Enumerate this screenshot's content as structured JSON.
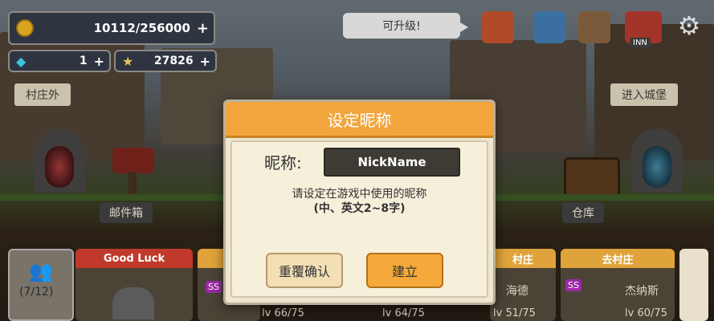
{
  "currency": {
    "gold": "10112/256000",
    "gems": "1",
    "stars": "27826",
    "plus": "+"
  },
  "tooltip": "可升级!",
  "top_icons": [
    "forge-icon",
    "shop-icon",
    "gem-cart-icon",
    "inn-icon",
    "gear-icon"
  ],
  "inn_label": "INN",
  "signs": {
    "left": "村庄外",
    "right": "进入城堡"
  },
  "labels": {
    "mailbox": "邮件箱",
    "warehouse": "仓库"
  },
  "party": {
    "count": "(7/12)",
    "good_luck": "Good Luck",
    "village": "村庄",
    "go_village": "去村庄",
    "hero1_name": "海德",
    "hero2_name": "杰纳斯",
    "levels": [
      "lv 66/75",
      "lv 64/75",
      "lv 51/75",
      "lv 60/75"
    ],
    "badge": "SS"
  },
  "dialog": {
    "title": "设定昵称",
    "nick_label": "昵称:",
    "nick_value": "NickName",
    "desc_line1": "请设定在游戏中使用的昵称",
    "desc_line2": "(中、英文2~8字)",
    "confirm_label": "重覆确认",
    "create_label": "建立"
  },
  "colors": {
    "dialog_header": "#f2a53c",
    "create_button": "#f4a93a",
    "confirm_button": "#f2dfb5",
    "good_luck_header": "#c0392b"
  }
}
